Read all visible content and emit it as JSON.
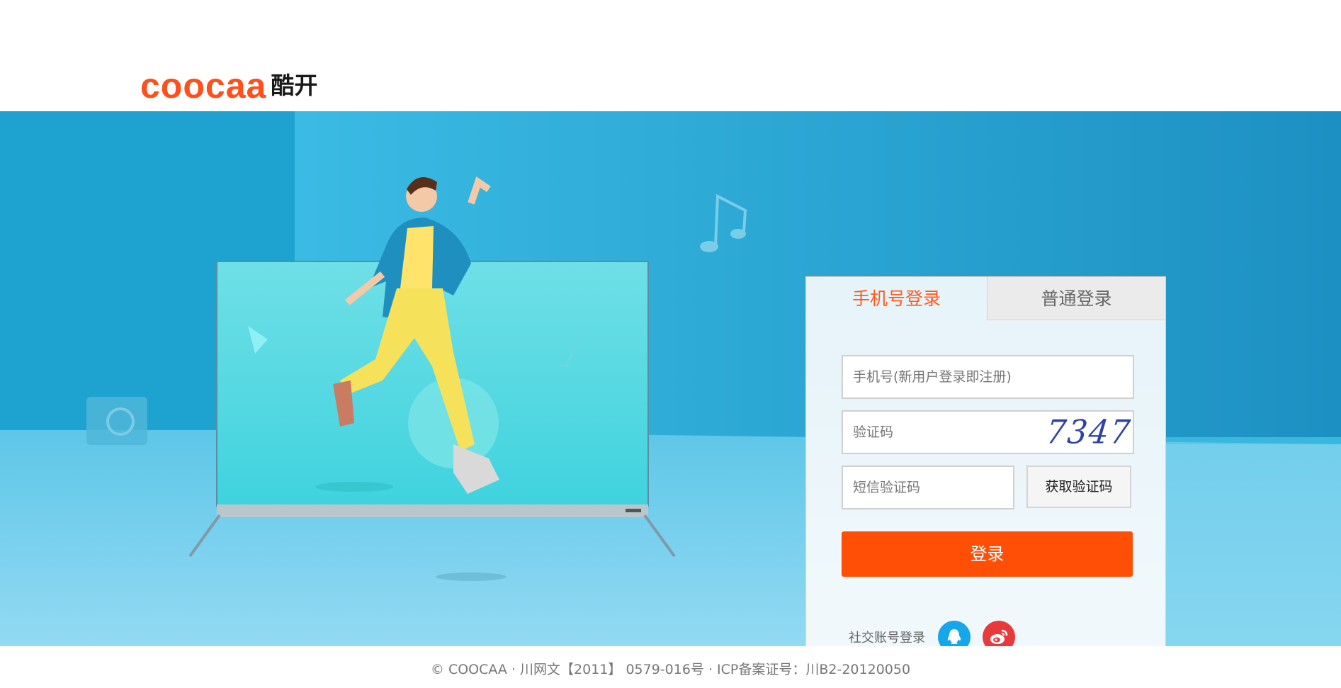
{
  "brand": {
    "logo_en": "coocaa",
    "logo_cn": "酷开",
    "accent_color": "#ff4f1a"
  },
  "login": {
    "tabs": [
      {
        "label": "手机号登录",
        "active": true
      },
      {
        "label": "普通登录",
        "active": false
      }
    ],
    "phone_placeholder": "手机号(新用户登录即注册)",
    "captcha_placeholder": "验证码",
    "captcha_code": "7347",
    "sms_placeholder": "短信验证码",
    "sms_button": "获取验证码",
    "submit": "登录",
    "social_label": "社交账号登录",
    "social_icons": [
      "qq-icon",
      "weibo-icon"
    ],
    "button_color": "#ff4e05"
  },
  "footer": {
    "text": "© COOCAA · 川网文【2011】 0579-016号 · ICP备案证号：川B2-20120050"
  }
}
